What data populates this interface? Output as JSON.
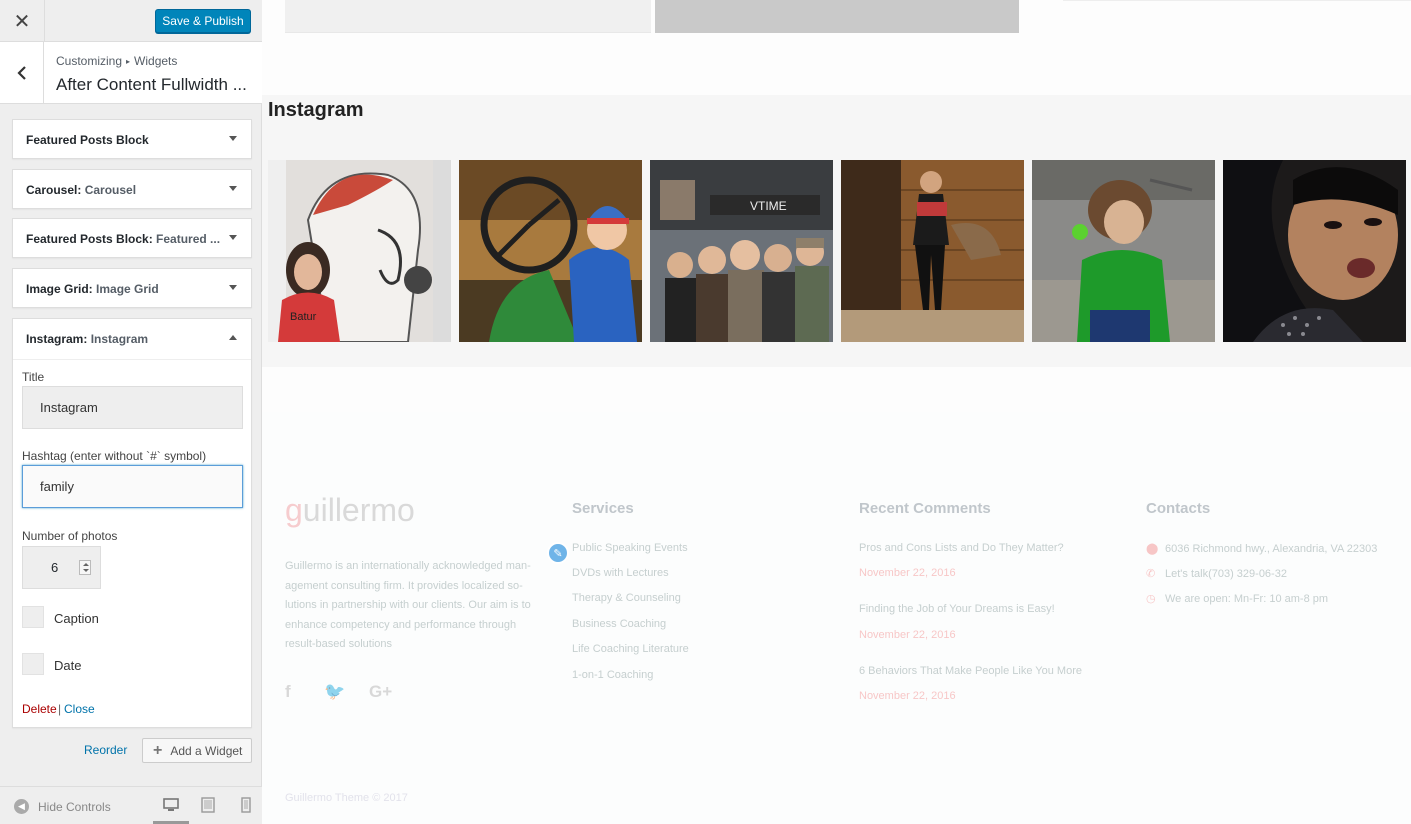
{
  "header": {
    "close": "✕",
    "save_label": "Save & Publish"
  },
  "title_bar": {
    "crumb_root": "Customizing",
    "crumb_separator": "▸",
    "crumb_section": "Widgets",
    "section_title": "After Content Fullwidth ..."
  },
  "widgets": [
    {
      "type": "Featured Posts Block",
      "instance": ""
    },
    {
      "type": "Carousel:",
      "instance": "Carousel"
    },
    {
      "type": "Featured Posts Block:",
      "instance": "Featured ..."
    },
    {
      "type": "Image Grid:",
      "instance": "Image Grid"
    }
  ],
  "instagram_widget": {
    "type": "Instagram:",
    "instance": "Instagram",
    "title_label": "Title",
    "title_value": "Instagram",
    "hashtag_label": "Hashtag (enter without `#` symbol)",
    "hashtag_value": "family",
    "photos_label": "Number of photos",
    "photos_value": "6",
    "caption_label": "Caption",
    "caption_checked": false,
    "date_label": "Date",
    "date_checked": false,
    "delete_label": "Delete",
    "separator": "|",
    "close_label": "Close"
  },
  "actions": {
    "reorder": "Reorder",
    "add_widget": "Add a Widget",
    "add_icon": "+"
  },
  "footer_controls": {
    "hide_controls": "Hide Controls"
  },
  "preview": {
    "instagram_title": "Instagram",
    "footer": {
      "logo_first": "g",
      "logo_rest": "uillermo",
      "about_lines": [
        "Guillermo is an internationally acknowledged man-",
        "agement consulting firm. It provides localized so-",
        "lutions in partnership with our clients. Our aim is to",
        "enhance competency and performance through",
        "result-based solutions"
      ],
      "social": [
        "f",
        "🐦",
        "G+"
      ],
      "services_heading": "Services",
      "services": [
        "Public Speaking Events",
        "DVDs with Lectures",
        "Therapy & Counseling",
        "Business Coaching",
        "Life Coaching Literature",
        "1-on-1 Coaching"
      ],
      "comments_heading": "Recent Comments",
      "comments": [
        {
          "title": "Pros and Cons Lists and Do They Matter?",
          "date": "November 22, 2016"
        },
        {
          "title": "Finding the Job of Your Dreams is Easy!",
          "date": "November 22, 2016"
        },
        {
          "title": "6 Behaviors That Make People Like You More",
          "date": "November 22, 2016"
        }
      ],
      "contacts_heading": "Contacts",
      "contacts": [
        {
          "icon": "map-pin",
          "glyph": "⬤",
          "text": "6036 Richmond hwy., Alexandria, VA 22303"
        },
        {
          "icon": "phone",
          "glyph": "✆",
          "text": "Let's talk(703) 329-06-32"
        },
        {
          "icon": "clock",
          "glyph": "◷",
          "text": "We are open: Mn-Fr: 10 am-8 pm"
        }
      ],
      "copyright": "Guillermo Theme © 2017"
    }
  },
  "colors": {
    "primary_button": "#0085ba",
    "delete": "#a00",
    "link": "#0073aa",
    "accent": "#f39a9a"
  }
}
